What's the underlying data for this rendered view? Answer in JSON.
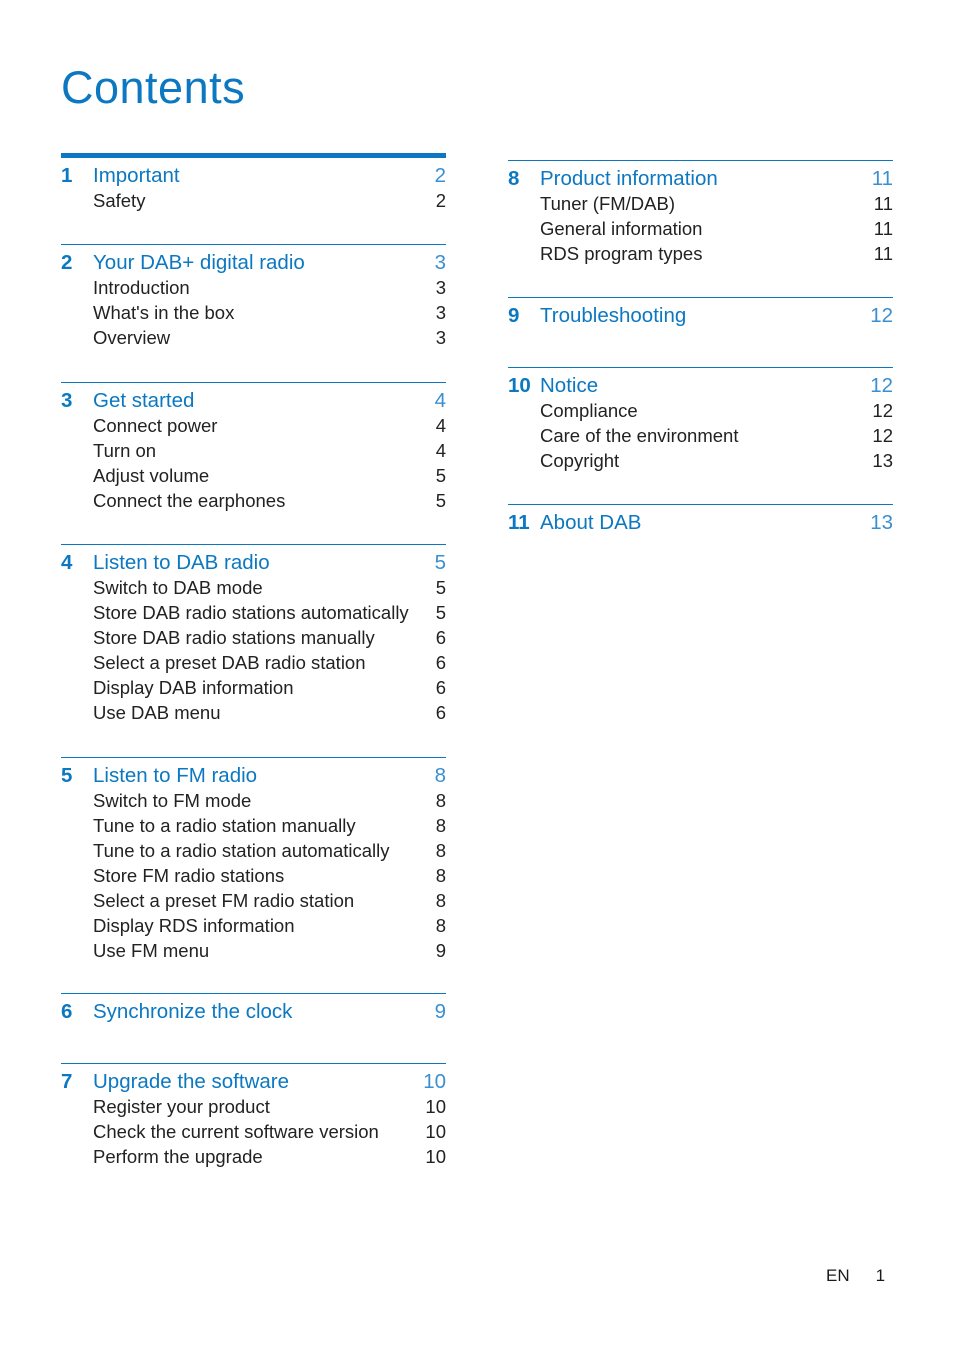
{
  "page_title": "Contents",
  "colors": {
    "accent": "#0b78c1"
  },
  "left_column": [
    {
      "number": "1",
      "title": "Important",
      "page": "2",
      "entries": [
        {
          "label": "Safety",
          "page": "2"
        }
      ]
    },
    {
      "number": "2",
      "title": "Your DAB+ digital radio",
      "page": "3",
      "entries": [
        {
          "label": "Introduction",
          "page": "3"
        },
        {
          "label": "What's in the box",
          "page": "3"
        },
        {
          "label": "Overview",
          "page": "3"
        }
      ]
    },
    {
      "number": "3",
      "title": "Get started",
      "page": "4",
      "entries": [
        {
          "label": "Connect power",
          "page": "4"
        },
        {
          "label": "Turn on",
          "page": "4"
        },
        {
          "label": "Adjust volume",
          "page": "5"
        },
        {
          "label": "Connect the earphones",
          "page": "5"
        }
      ]
    },
    {
      "number": "4",
      "title": "Listen to DAB radio",
      "page": "5",
      "entries": [
        {
          "label": "Switch to DAB mode",
          "page": "5"
        },
        {
          "label": "Store DAB radio stations automatically",
          "page": "5"
        },
        {
          "label": "Store DAB radio stations manually",
          "page": "6"
        },
        {
          "label": "Select a preset DAB radio station",
          "page": "6"
        },
        {
          "label": "Display DAB information",
          "page": "6"
        },
        {
          "label": "Use DAB menu",
          "page": "6"
        }
      ]
    },
    {
      "number": "5",
      "title": "Listen to FM radio",
      "page": "8",
      "entries": [
        {
          "label": "Switch to FM mode",
          "page": "8"
        },
        {
          "label": "Tune to a radio station manually",
          "page": "8"
        },
        {
          "label": "Tune to a radio station automatically",
          "page": "8"
        },
        {
          "label": "Store FM radio stations",
          "page": "8"
        },
        {
          "label": "Select a preset FM radio station",
          "page": "8"
        },
        {
          "label": "Display RDS information",
          "page": "8"
        },
        {
          "label": "Use FM menu",
          "page": "9"
        }
      ]
    },
    {
      "number": "6",
      "title": "Synchronize the clock",
      "page": "9",
      "entries": []
    },
    {
      "number": "7",
      "title": "Upgrade the software",
      "page": "10",
      "entries": [
        {
          "label": "Register your product",
          "page": "10"
        },
        {
          "label": "Check the current software version",
          "page": "10"
        },
        {
          "label": "Perform the upgrade",
          "page": "10"
        }
      ]
    }
  ],
  "right_column": [
    {
      "number": "8",
      "title": "Product information",
      "page": "11",
      "entries": [
        {
          "label": "Tuner (FM/DAB)",
          "page": "11"
        },
        {
          "label": "General information",
          "page": "11"
        },
        {
          "label": "RDS program types",
          "page": "11"
        }
      ]
    },
    {
      "number": "9",
      "title": "Troubleshooting",
      "page": "12",
      "entries": []
    },
    {
      "number": "10",
      "title": "Notice",
      "page": "12",
      "entries": [
        {
          "label": "Compliance",
          "page": "12"
        },
        {
          "label": "Care of the environment",
          "page": "12"
        },
        {
          "label": "Copyright",
          "page": "13"
        }
      ]
    },
    {
      "number": "11",
      "title": "About DAB",
      "page": "13",
      "entries": []
    }
  ],
  "footer": {
    "language": "EN",
    "page_number": "1"
  }
}
